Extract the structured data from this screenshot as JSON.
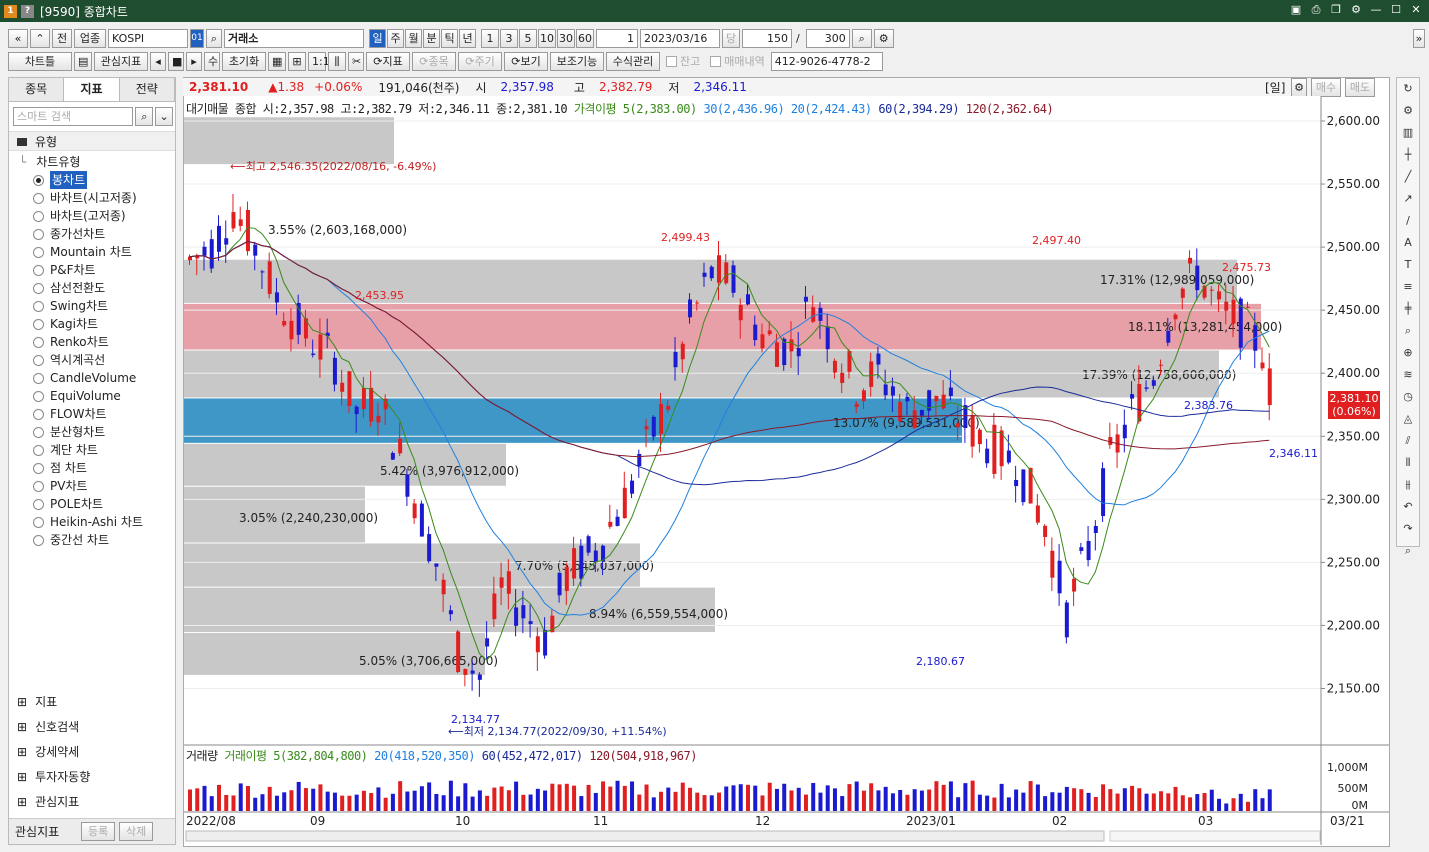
{
  "window": {
    "title": "[9590] 종합차트",
    "icons": [
      "doc-icon",
      "help-icon"
    ],
    "controls": [
      "layout-icon",
      "print-icon",
      "copy-icon",
      "settings-icon",
      "minimize-icon",
      "maximize-icon",
      "close-icon"
    ]
  },
  "toolbar1": {
    "nav_prev": "«",
    "nav_up": "⌃",
    "jeon": "전",
    "upjong": "업종",
    "market": "KOSPI",
    "market_code": "01",
    "search_icon": "⌕",
    "exchange": "거래소",
    "periods": [
      "일",
      "주",
      "월",
      "분",
      "틱",
      "년"
    ],
    "period_selected": "일",
    "minutes": [
      "1",
      "3",
      "5",
      "10",
      "30",
      "60"
    ],
    "unit_value": "1",
    "date": "2023/03/16",
    "dang": "당",
    "count": "150",
    "slash": "/",
    "total": "300",
    "more": "»"
  },
  "toolbar2": {
    "chartle": "차트틀",
    "interest_label": "관심지표",
    "su": "수",
    "reset": "초기화",
    "indicator": "지표",
    "item": "종목",
    "cycle": "주기",
    "view": "보기",
    "aux": "보조기능",
    "formula": "수식관리",
    "balance": "잔고",
    "trades": "매매내역",
    "account": "412-9026-4778-2"
  },
  "left_panel": {
    "tabs": [
      "종목",
      "지표",
      "전략"
    ],
    "active_tab": "지표",
    "search_placeholder": "스마트 검색",
    "section": "유형",
    "tree_title": "차트유형",
    "chart_types": [
      "봉차트",
      "바차트(시고저종)",
      "바차트(고저종)",
      "종가선차트",
      "Mountain 차트",
      "P&F차트",
      "삼선전환도",
      "Swing차트",
      "Kagi차트",
      "Renko차트",
      "역시계곡선",
      "CandleVolume",
      "EquiVolume",
      "FLOW차트",
      "분산형차트",
      "계단 차트",
      "점 차트",
      "PV차트",
      "POLE차트",
      "Heikin-Ashi 차트",
      "중간선 차트"
    ],
    "selected_type": "봉차트",
    "bottom_sections": [
      "지표",
      "신호검색",
      "강세약세",
      "투자자동향",
      "관심지표"
    ],
    "footer_label": "관심지표",
    "register": "등록",
    "delete": "삭제"
  },
  "info": {
    "price": "2,381.10",
    "change": "▲1.38",
    "pct": "+0.06%",
    "volume": "191,046(천주)",
    "open_label": "시",
    "open": "2,357.98",
    "high_label": "고",
    "high": "2,382.79",
    "low_label": "저",
    "low": "2,346.11",
    "period_tag": "[일]",
    "buy": "매수",
    "sell": "매도"
  },
  "legend": {
    "dae": "대기매물",
    "main": "종합 시:2,357.98 고:2,382.79 저:2,346.11 종:2,381.10",
    "ma5": "가격이평 5(2,383.00)",
    "ma30": "30(2,436.96)",
    "ma20": "20(2,424.43)",
    "ma60": "60(2,394.29)",
    "ma120": "120(2,362.64)"
  },
  "vol_legend": {
    "title": "거래량",
    "ma5": "거래이평 5(382,804,800)",
    "ma20": "20(418,520,350)",
    "ma60": "60(452,472,017)",
    "ma120": "120(504,918,967)"
  },
  "annotations": {
    "max": "최고 2,546.35(2022/08/16, -6.49%)",
    "min": "최저 2,134.77(2022/09/30, +11.54%)",
    "p1": "2,499.43",
    "p2": "2,497.40",
    "p3": "2,475.73",
    "p4": "2,453.95",
    "p5": "2,383.76",
    "p6": "2,346.11",
    "p7": "2,180.67",
    "p8": "2,134.77"
  },
  "price_axis": [
    "2,600.00",
    "2,550.00",
    "2,500.00",
    "2,450.00",
    "2,400.00",
    "2,350.00",
    "2,300.00",
    "2,250.00",
    "2,200.00",
    "2,150.00"
  ],
  "current_price_tag": {
    "price": "2,381.10",
    "pct": "(0.06%)"
  },
  "volume_axis": [
    "1,000M",
    "500M",
    "0M"
  ],
  "x_labels": [
    "2022/08",
    "09",
    "10",
    "11",
    "12",
    "2023/01",
    "02",
    "03"
  ],
  "x_current": "03/21",
  "volume_profile": [
    {
      "label": "3.55% (2,603,168,000)",
      "color": "#c8c8c8"
    },
    {
      "label": "17.31% (12,989,059,000)",
      "color": "#c8c8c8"
    },
    {
      "label": "18.11% (13,281,454,000)",
      "color": "#e8a0a8"
    },
    {
      "label": "17.39% (12,758,606,000)",
      "color": "#c8c8c8"
    },
    {
      "label": "13.07% (9,589,531,000)",
      "color": "#3f97c8"
    },
    {
      "label": "5.42% (3,976,912,000)",
      "color": "#c8c8c8"
    },
    {
      "label": "3.05% (2,240,230,000)",
      "color": "#c8c8c8"
    },
    {
      "label": "7.70% (5,645,037,000)",
      "color": "#c8c8c8"
    },
    {
      "label": "8.94% (6,559,554,000)",
      "color": "#c8c8c8"
    },
    {
      "label": "5.05% (3,706,665,000)",
      "color": "#c8c8c8"
    }
  ],
  "colors": {
    "up": "#e02020",
    "down": "#1a1ad0",
    "ma5": "#3a8a1a",
    "ma20": "#2080e0",
    "ma60": "#1a2a9a",
    "ma120": "#8a1a2a"
  }
}
